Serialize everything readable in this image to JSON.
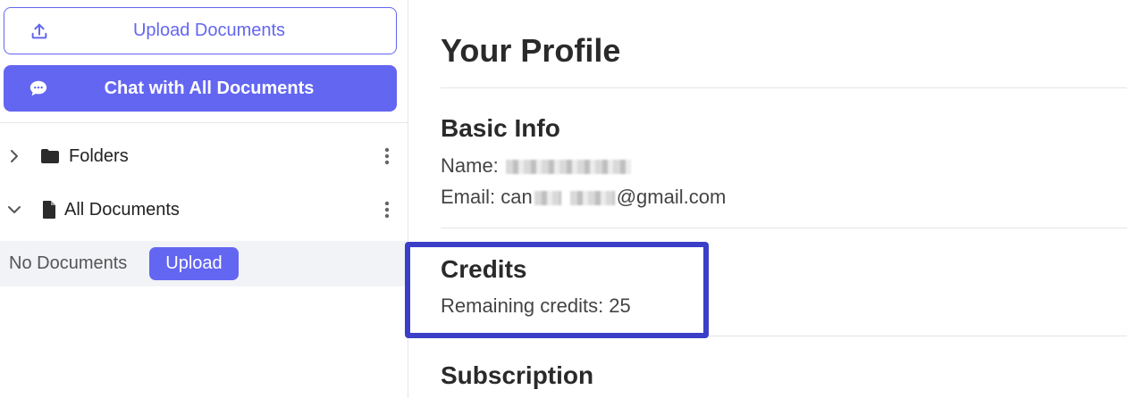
{
  "sidebar": {
    "upload_button_label": "Upload Documents",
    "chat_button_label": "Chat with All Documents",
    "tree": {
      "folders_label": "Folders",
      "all_documents_label": "All Documents"
    },
    "empty_state": {
      "text": "No Documents",
      "upload_label": "Upload"
    }
  },
  "main": {
    "title": "Your Profile",
    "basic_info": {
      "heading": "Basic Info",
      "name_label": "Name:",
      "email_prefix": "Email: can",
      "email_suffix": "@gmail.com"
    },
    "credits": {
      "heading": "Credits",
      "remaining_text": "Remaining credits: 25"
    },
    "subscription": {
      "heading": "Subscription"
    }
  },
  "colors": {
    "accent": "#6366f1",
    "highlight_border": "#3b3fc8"
  },
  "icons": [
    "upload-icon",
    "chat-bubble-icon",
    "chevron-right-icon",
    "folder-icon",
    "kebab-menu-icon",
    "chevron-down-icon",
    "document-icon"
  ]
}
